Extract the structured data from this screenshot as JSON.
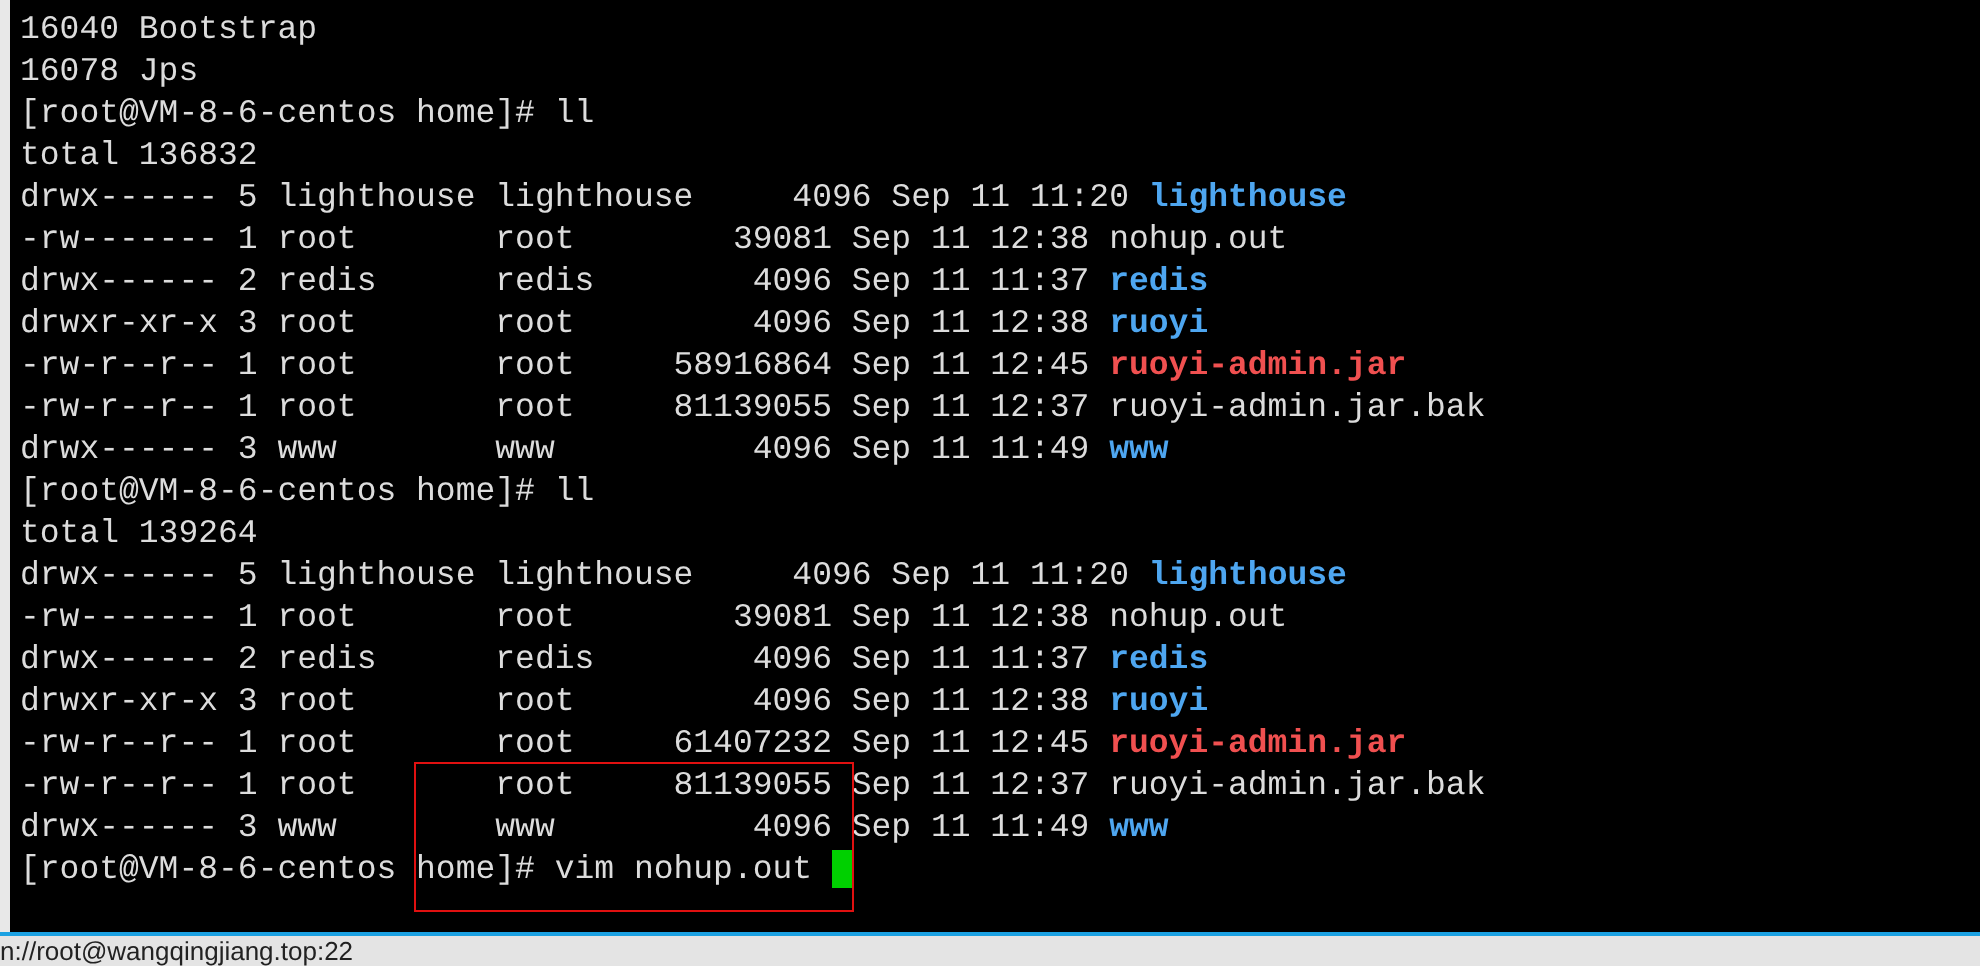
{
  "terminal": {
    "lines": [
      {
        "kind": "output",
        "text": "16040 Bootstrap"
      },
      {
        "kind": "output",
        "text": "16078 Jps"
      },
      {
        "kind": "prompt",
        "text": "[root@VM-8-6-centos home]# ll"
      },
      {
        "kind": "output",
        "text": "total 136832"
      },
      {
        "kind": "entry",
        "info": "drwx------ 5 lighthouse lighthouse     4096 Sep 11 11:20",
        "name": "lighthouse",
        "color": "#4ea6f0",
        "bold": true
      },
      {
        "kind": "entry",
        "info": "-rw------- 1 root       root        39081 Sep 11 12:38",
        "name": "nohup.out",
        "color": "#dcdcdc",
        "bold": false
      },
      {
        "kind": "entry",
        "info": "drwx------ 2 redis      redis        4096 Sep 11 11:37",
        "name": "redis",
        "color": "#4ea6f0",
        "bold": true
      },
      {
        "kind": "entry",
        "info": "drwxr-xr-x 3 root       root         4096 Sep 11 12:38",
        "name": "ruoyi",
        "color": "#4ea6f0",
        "bold": true
      },
      {
        "kind": "entry",
        "info": "-rw-r--r-- 1 root       root     58916864 Sep 11 12:45",
        "name": "ruoyi-admin.jar",
        "color": "#f05050",
        "bold": true
      },
      {
        "kind": "entry",
        "info": "-rw-r--r-- 1 root       root     81139055 Sep 11 12:37",
        "name": "ruoyi-admin.jar.bak",
        "color": "#dcdcdc",
        "bold": false
      },
      {
        "kind": "entry",
        "info": "drwx------ 3 www        www          4096 Sep 11 11:49",
        "name": "www",
        "color": "#4ea6f0",
        "bold": true
      },
      {
        "kind": "prompt",
        "text": "[root@VM-8-6-centos home]# ll"
      },
      {
        "kind": "output",
        "text": "total 139264"
      },
      {
        "kind": "entry",
        "info": "drwx------ 5 lighthouse lighthouse     4096 Sep 11 11:20",
        "name": "lighthouse",
        "color": "#4ea6f0",
        "bold": true
      },
      {
        "kind": "entry",
        "info": "-rw------- 1 root       root        39081 Sep 11 12:38",
        "name": "nohup.out",
        "color": "#dcdcdc",
        "bold": false
      },
      {
        "kind": "entry",
        "info": "drwx------ 2 redis      redis        4096 Sep 11 11:37",
        "name": "redis",
        "color": "#4ea6f0",
        "bold": true
      },
      {
        "kind": "entry",
        "info": "drwxr-xr-x 3 root       root         4096 Sep 11 12:38",
        "name": "ruoyi",
        "color": "#4ea6f0",
        "bold": true
      },
      {
        "kind": "entry",
        "info": "-rw-r--r-- 1 root       root     61407232 Sep 11 12:45",
        "name": "ruoyi-admin.jar",
        "color": "#f05050",
        "bold": true
      },
      {
        "kind": "entry",
        "info": "-rw-r--r-- 1 root       root     81139055 Sep 11 12:37",
        "name": "ruoyi-admin.jar.bak",
        "color": "#dcdcdc",
        "bold": false
      },
      {
        "kind": "entry",
        "info": "drwx------ 3 www        www          4096 Sep 11 11:49",
        "name": "www",
        "color": "#4ea6f0",
        "bold": true
      },
      {
        "kind": "prompt",
        "text": "[root@VM-8-6-centos home]# vim nohup.out",
        "cursor": true
      }
    ],
    "highlight_box": true
  },
  "status_bar": {
    "text": "n://root@wangqingjiang.top:22"
  }
}
